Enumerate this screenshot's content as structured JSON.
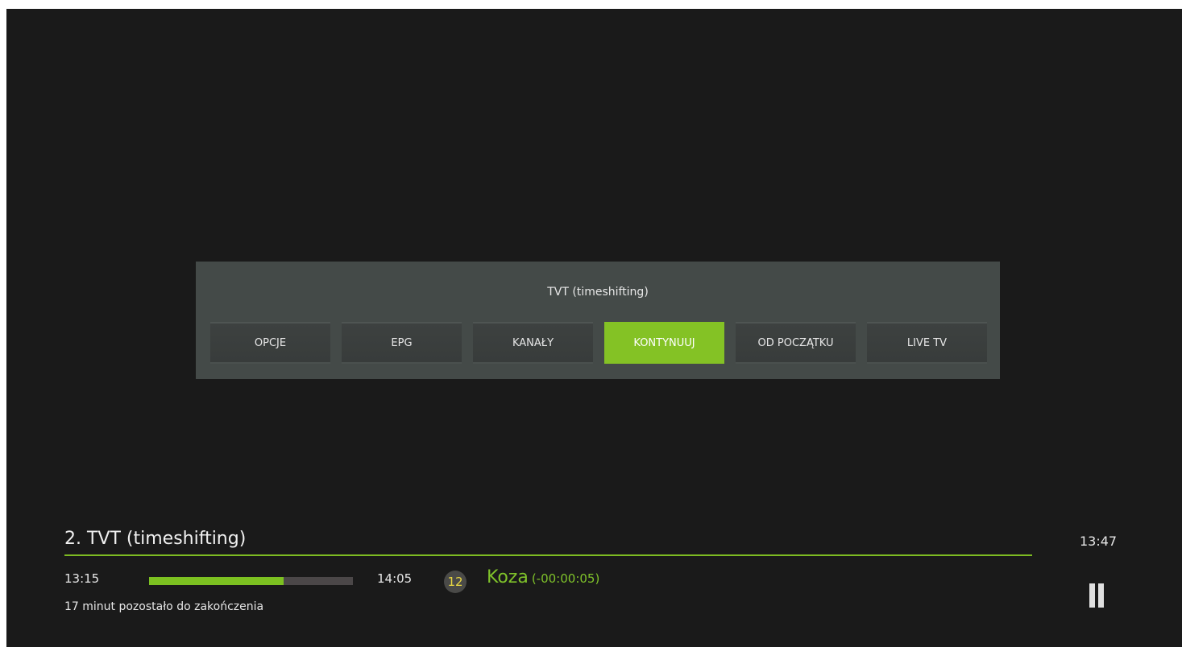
{
  "menu": {
    "title": "TVT (timeshifting)",
    "buttons": [
      {
        "label": "OPCJE",
        "active": false
      },
      {
        "label": "EPG",
        "active": false
      },
      {
        "label": "KANAŁY",
        "active": false
      },
      {
        "label": "KONTYNUUJ",
        "active": true
      },
      {
        "label": "OD POCZĄTKU",
        "active": false
      },
      {
        "label": "LIVE TV",
        "active": false
      }
    ]
  },
  "info": {
    "channel_title": "2. TVT (timeshifting)",
    "clock": "13:47",
    "start_time": "13:15",
    "end_time": "14:05",
    "progress_percent": 66,
    "age_rating": "12",
    "program_name": "Koza",
    "time_offset": "(-00:00:05)",
    "remaining_text": "17 minut pozostało do zakończenia"
  },
  "colors": {
    "accent": "#84c225",
    "background": "#1a1a1a",
    "panel": "#444a48"
  },
  "icons": {
    "playback_state": "pause-icon"
  }
}
